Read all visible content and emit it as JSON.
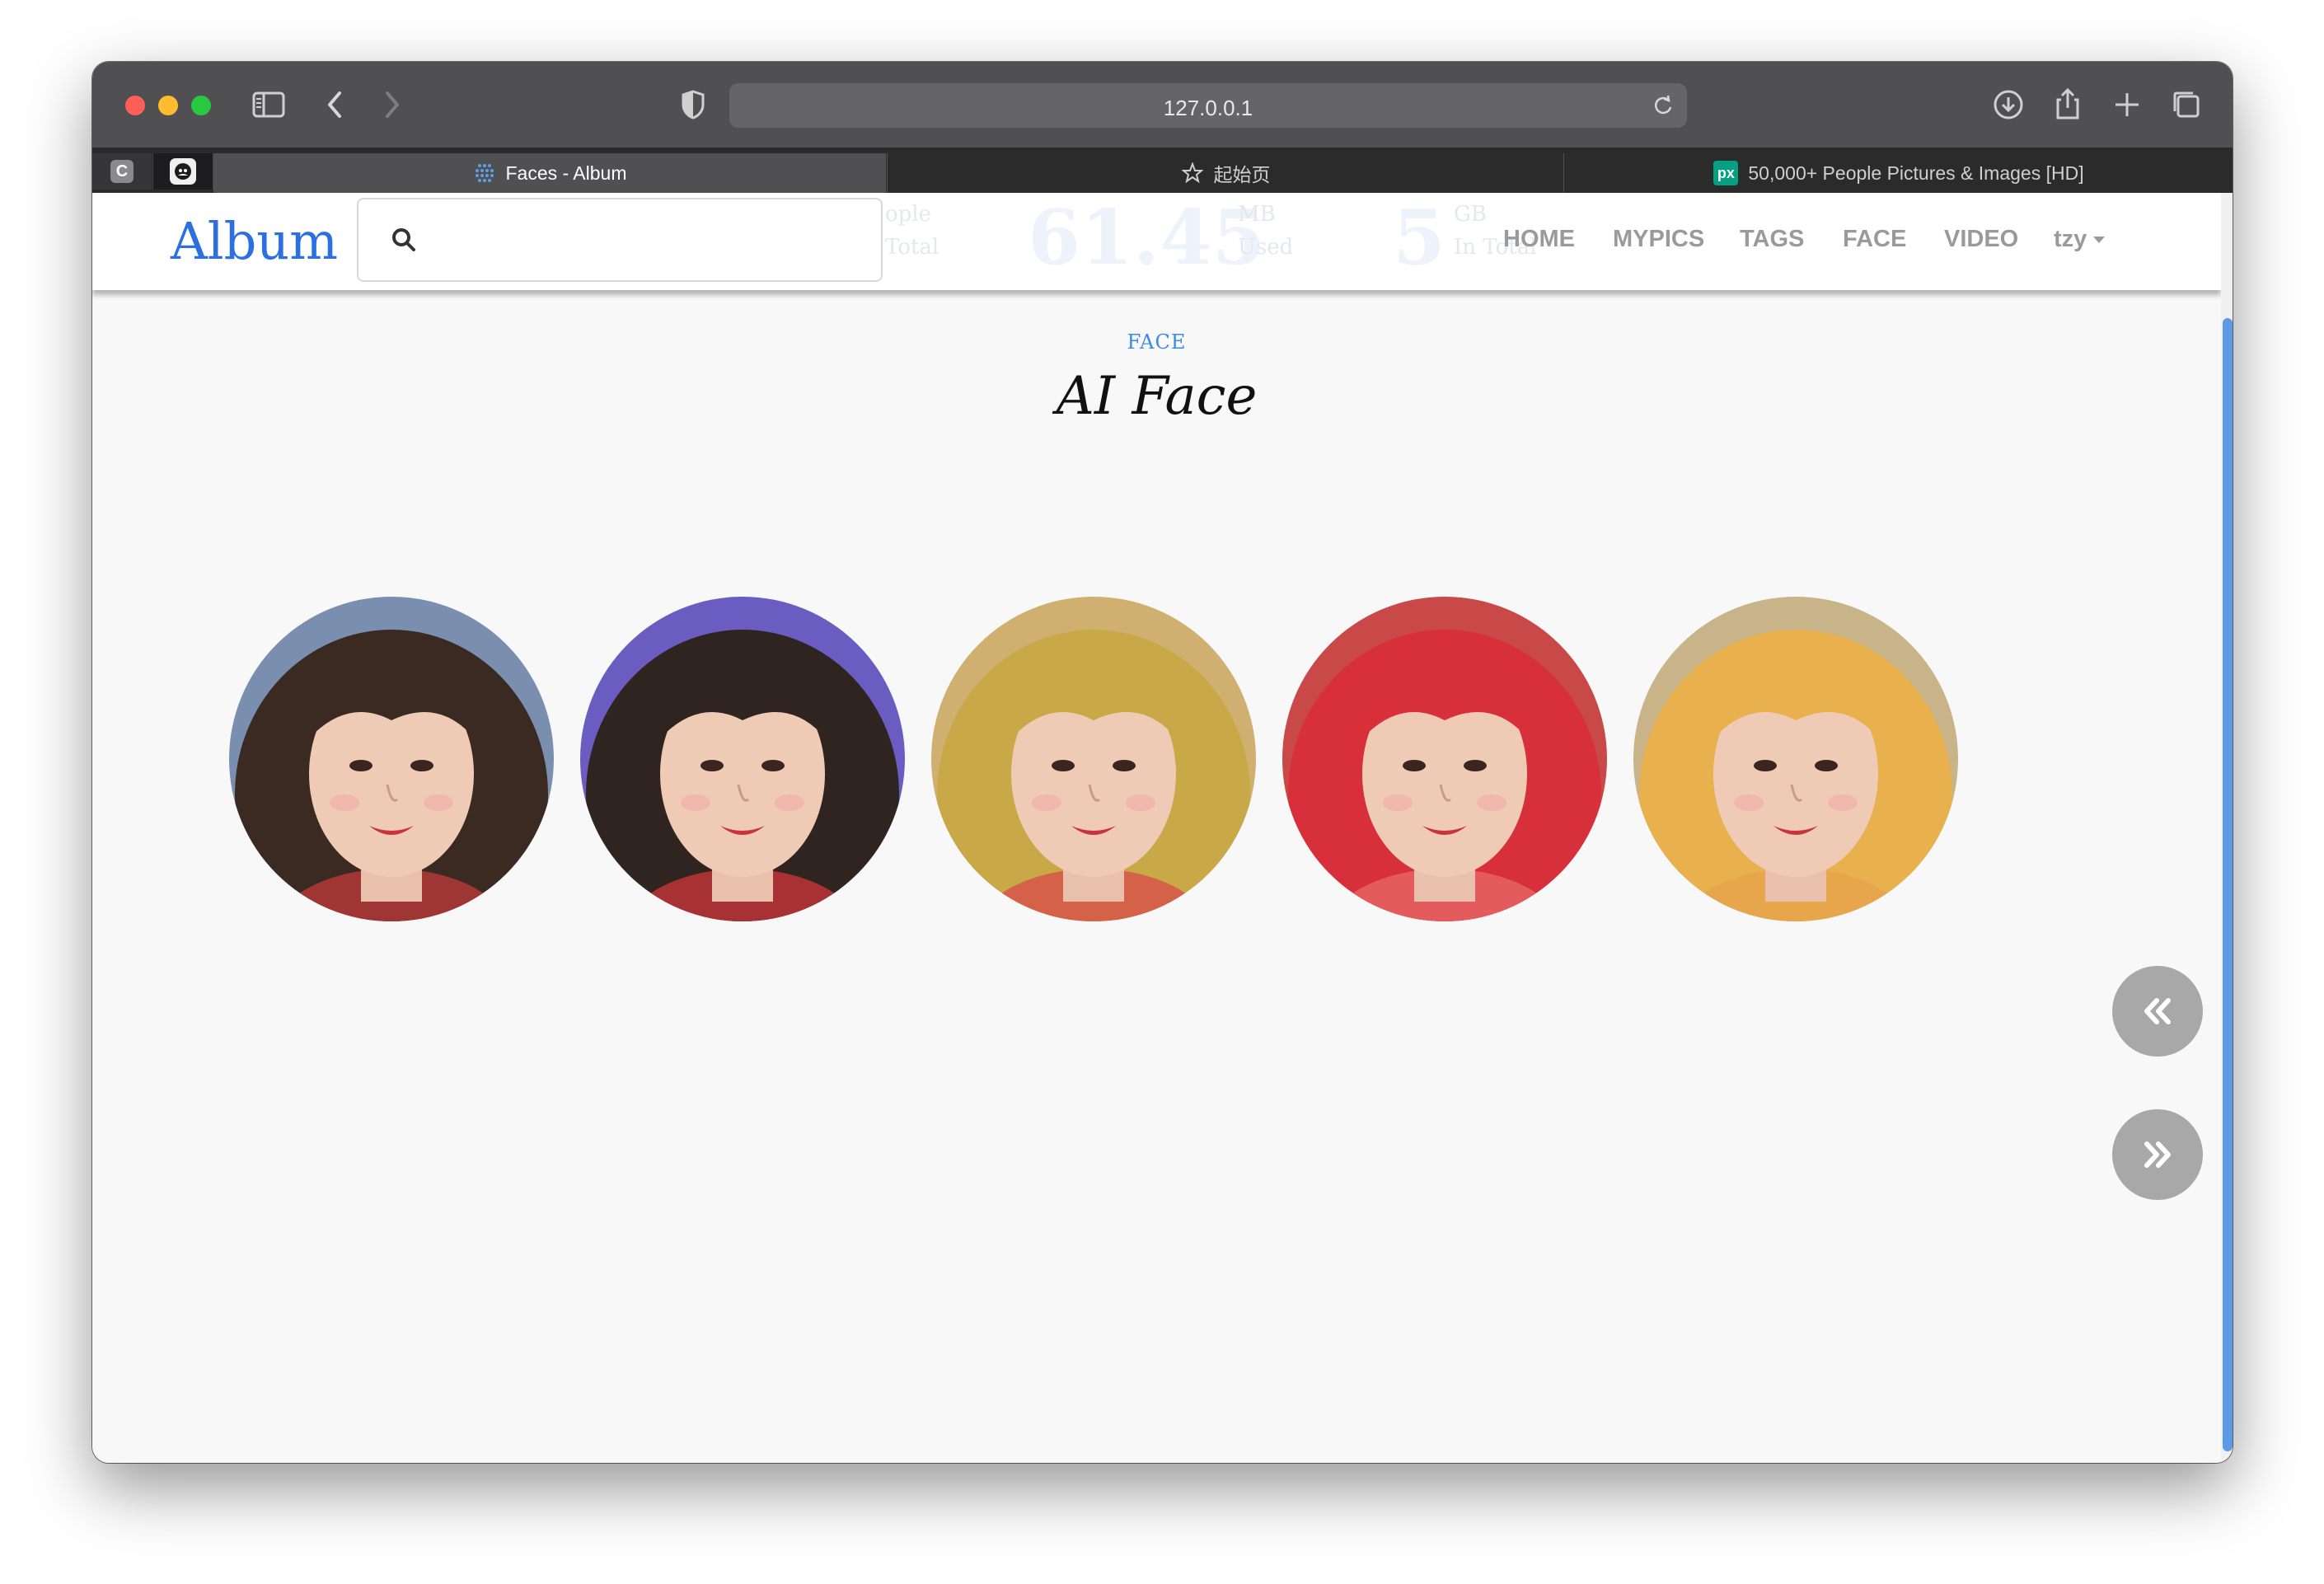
{
  "browser": {
    "url": "127.0.0.1",
    "tabs": [
      {
        "title": "Faces - Album",
        "active": true
      },
      {
        "title": "起始页",
        "active": false
      },
      {
        "title": "50,000+ People Pictures & Images [HD]",
        "active": false
      }
    ],
    "pinned_tab_label": "C"
  },
  "navbar": {
    "brand": "Album",
    "search_value": "",
    "ghost_stats": {
      "people_label": "ople",
      "people_sub": "Total",
      "used_value": "61.45",
      "used_unit": "MB",
      "used_sub": "Used",
      "gb_value": "5",
      "gb_unit": "GB",
      "gb_sub": "In Total"
    },
    "menu": [
      "HOME",
      "MYPICS",
      "TAGS",
      "FACE",
      "VIDEO"
    ],
    "user": "tzy"
  },
  "section": {
    "eyebrow": "FACE",
    "title": "AI Face"
  },
  "faces": [
    {
      "hair": "#3a2a22",
      "bg": "#7a8fb0",
      "accent": "#c23b3b"
    },
    {
      "hair": "#2f2420",
      "bg": "#6a5cc0",
      "accent": "#d2353a"
    },
    {
      "hair": "#c9a848",
      "bg": "#d0b070",
      "accent": "#d84a4a"
    },
    {
      "hair": "#d8303a",
      "bg": "#c94848",
      "accent": "#e86a6a"
    },
    {
      "hair": "#e9b04e",
      "bg": "#c8b488",
      "accent": "#e6a24c"
    }
  ],
  "pager": {
    "prev_icon": "double-chevron-left-icon",
    "next_icon": "double-chevron-right-icon"
  }
}
